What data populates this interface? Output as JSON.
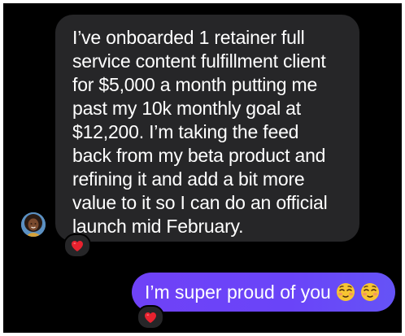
{
  "conversation": {
    "incoming_message": {
      "lines": [
        "I’ve onboarded 1 retainer full",
        "service content fulfillment client",
        "for $5,000 a month putting me",
        "past my 10k monthly goal at",
        "$12,200. I’m taking the feed",
        "back from my beta product and",
        "refining it and add a bit more",
        "value to it so I can do an official",
        "launch mid February."
      ],
      "reaction": "red-heart-icon"
    },
    "outgoing_message": {
      "text": "I’m super proud of you",
      "emojis": [
        "relieved-face-icon",
        "relieved-face-icon"
      ],
      "reaction": "red-heart-icon"
    }
  },
  "colors": {
    "background": "#000000",
    "incoming_bubble": "#262628",
    "outgoing_bubble": "#6a44f8",
    "heart": "#e8222f",
    "text": "#ffffff"
  }
}
